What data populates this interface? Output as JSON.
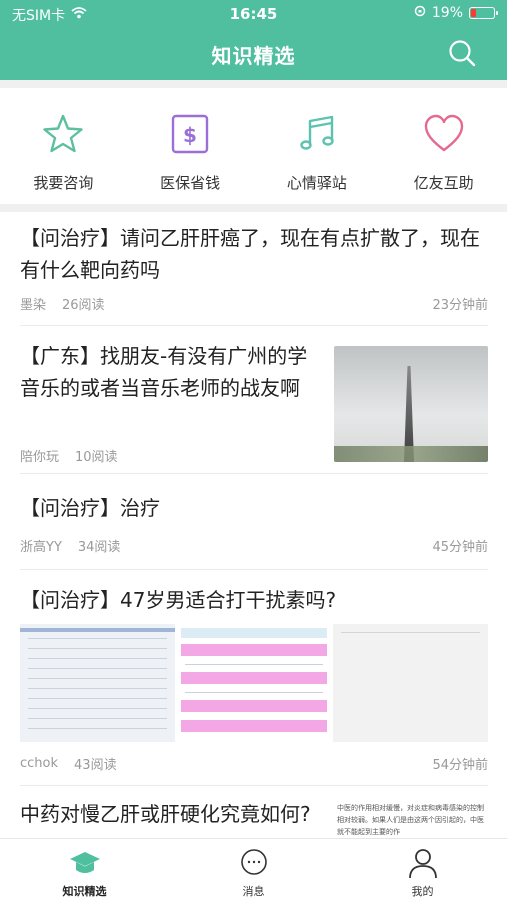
{
  "status_bar": {
    "carrier": "无SIM卡",
    "time": "16:45",
    "battery": "19%"
  },
  "nav": {
    "title": "知识精选",
    "search_icon": "search-icon"
  },
  "colors": {
    "brand": "#4fbf9f",
    "star": "#5cbf9f",
    "dollar": "#9b6fd6",
    "music": "#5bc3b0",
    "heart": "#e56a8f"
  },
  "quick_actions": [
    {
      "label": "我要咨询",
      "icon": "star-icon"
    },
    {
      "label": "医保省钱",
      "icon": "dollar-icon"
    },
    {
      "label": "心情驿站",
      "icon": "music-note-icon"
    },
    {
      "label": "亿友互助",
      "icon": "heart-icon"
    }
  ],
  "posts": [
    {
      "title": "【问治疗】请问乙肝肝癌了，现在有点扩散了，现在有什么靶向药吗",
      "author": "墨染",
      "reads": "26阅读",
      "time": "23分钟前"
    },
    {
      "title": "【广东】找朋友-有没有广州的学音乐的或者当音乐老师的战友啊",
      "author": "陪你玩",
      "reads": "10阅读",
      "time": ""
    },
    {
      "title": "【问治疗】治疗",
      "author": "浙高YY",
      "reads": "34阅读",
      "time": "45分钟前"
    },
    {
      "title": "【问治疗】47岁男适合打干扰素吗?",
      "author": "cchok",
      "reads": "43阅读",
      "time": "54分钟前"
    },
    {
      "title": "中药对慢乙肝或肝硬化究竟如何?",
      "snippet": "中医的作用相对缓慢，对炎症和病毒感染的控制相对较弱。如果人们是由这两个因引起的，中医就不能起到主要的作"
    }
  ],
  "tabs": [
    {
      "label": "知识精选",
      "icon": "graduation-cap-icon",
      "active": true
    },
    {
      "label": "消息",
      "icon": "chat-bubble-icon",
      "active": false
    },
    {
      "label": "我的",
      "icon": "user-icon",
      "active": false
    }
  ]
}
